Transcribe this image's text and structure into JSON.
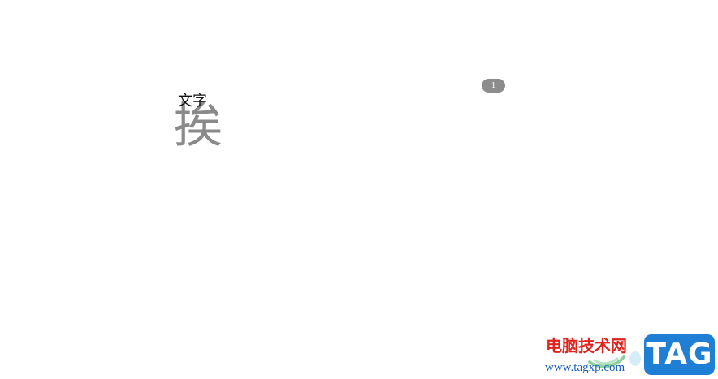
{
  "document": {
    "large_character": "挨",
    "text_label": "文字",
    "page_number": "1"
  },
  "watermark": {
    "title": "电脑技术网",
    "url": "www.tagxp.com",
    "badge": "TAG",
    "colors": {
      "title": "#e0231c",
      "url": "#1b5fb5",
      "badge_bg": "#1f7fd4"
    }
  }
}
